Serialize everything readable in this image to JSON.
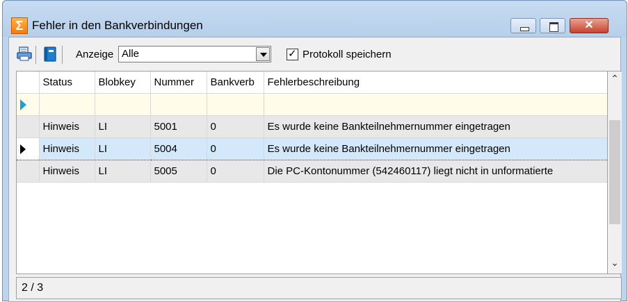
{
  "window": {
    "title": "Fehler in den Bankverbindungen",
    "controls": {
      "minimize_icon": "minimize-icon",
      "maximize_icon": "maximize-icon",
      "close_icon": "close-icon",
      "close_glyph": "✕"
    }
  },
  "toolbar": {
    "print_icon": "print-icon",
    "book_icon": "book-icon",
    "anzeige_label": "Anzeige",
    "filter": {
      "selected": "Alle"
    },
    "protokoll": {
      "label": "Protokoll speichern",
      "checked": true
    }
  },
  "grid": {
    "columns": [
      "Status",
      "Blobkey",
      "Nummer",
      "Bankverb",
      "Fehlerbeschreibung"
    ],
    "rows": [
      {
        "status": "Hinweis",
        "blobkey": "LI",
        "nummer": "5001",
        "bankverb": "0",
        "beschreibung": "Es wurde keine Bankteilnehmernummer eingetragen"
      },
      {
        "status": "Hinweis",
        "blobkey": "LI",
        "nummer": "5004",
        "bankverb": "0",
        "beschreibung": "Es wurde keine Bankteilnehmernummer eingetragen"
      },
      {
        "status": "Hinweis",
        "blobkey": "LI",
        "nummer": "5005",
        "bankverb": "0",
        "beschreibung": "Die PC-Kontonummer (542460117) liegt nicht in unformatierte"
      }
    ],
    "selected_row": 2
  },
  "statusbar": {
    "position": "2 / 3"
  },
  "colors": {
    "accent_orange": "#ff7a00",
    "selection": "#d4e8fb",
    "new_row": "#fffde9"
  }
}
